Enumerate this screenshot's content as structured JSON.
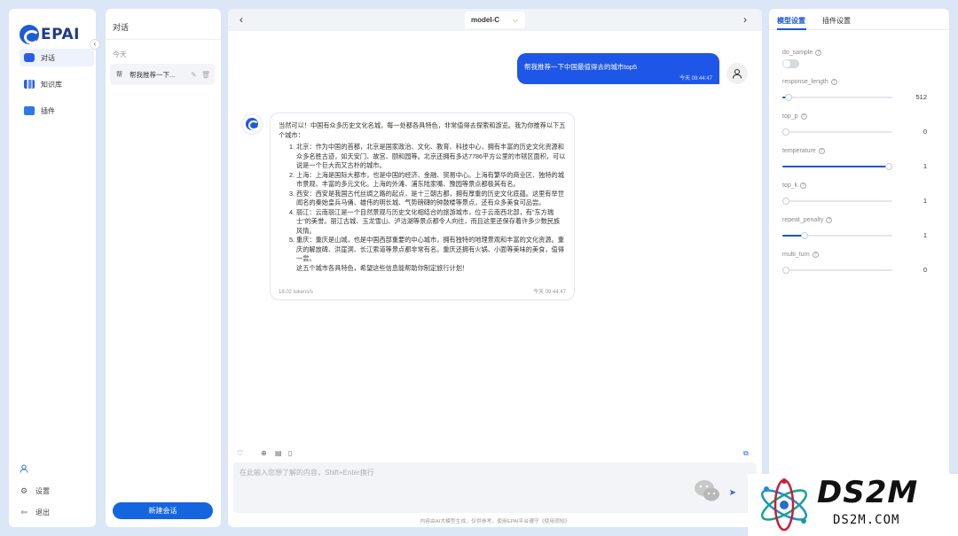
{
  "brand": {
    "name": "EPAI"
  },
  "nav": {
    "items": [
      {
        "label": "对话",
        "icon": "chat-icon",
        "active": true
      },
      {
        "label": "知识库",
        "icon": "books-icon",
        "active": false
      },
      {
        "label": "插件",
        "icon": "plugin-icon",
        "active": false
      }
    ],
    "footer": {
      "settings": "设置",
      "logout": "退出"
    }
  },
  "conversations": {
    "title": "对话",
    "group": "今天",
    "items": [
      {
        "title": "帮我推荐一下..."
      }
    ],
    "new_chat": "新建会话"
  },
  "chat": {
    "model": "model-C",
    "user_message": {
      "text": "帮我推荐一下中国最值得去的城市top5",
      "time": "今天 09:44:47"
    },
    "bot_message": {
      "intro": "当然可以！中国有众多历史文化名城，每一处都各具特色，非常值得去探索和游览。我为你推荐以下五个城市：",
      "items": [
        "北京：作为中国的首都，北京是国家政治、文化、教育、科技中心，拥有丰富的历史文化资源和众多名胜古迹，如天安门、故宫、颐和园等。北京还拥有多达7786平方公里的市辖区面积，可以说是一个巨大而又古朴的城市。",
        "上海：上海是国际大都市，也是中国的经济、金融、贸易中心。上海有繁华的商业区、独特的城市景观、丰富的多元文化。上海的外滩、浦东陆家嘴、豫园等景点都极其有名。",
        "西安：西安是我国古代丝绸之路的起点，是十三朝古都，拥有厚重的历史文化底蕴。这里有举世闻名的秦始皇兵马俑、雄伟的明长城、气势磅礴的钟鼓楼等景点，还有众多美食可品尝。",
        "丽江：云南丽江是一个自然景观与历史文化相结合的旅游城市，位于云南西北部，有\"东方瑞士\"的美誉。丽江古城、玉龙雪山、泸沽湖等景点都令人向往，而且这里还保存着许多少数民族风情。",
        "重庆：重庆是山城，也是中国西部重要的中心城市，拥有独特的地理景观和丰富的文化资源。重庆的解放碑、洪崖洞、长江索道等景点都非常有名。重庆还拥有火锅、小面等美味的美食，值得一尝。"
      ],
      "outro": "这五个城市各具特色，希望这些信息能帮助你制定旅行计划！",
      "speed": "18.02 tokens/s",
      "time": "今天 09:44:47"
    },
    "input_placeholder": "在此输入您想了解的内容，Shift+Enter换行",
    "disclaimer": "内容由AI大模型生成，仅供参考。使用EPAI平台遵守《使用须知》"
  },
  "settings": {
    "tabs": [
      "模型设置",
      "插件设置"
    ],
    "params": [
      {
        "name": "do_sample",
        "kind": "toggle",
        "on": false
      },
      {
        "name": "response_length",
        "kind": "slider",
        "value": "512",
        "level": 0.06
      },
      {
        "name": "top_p",
        "kind": "slider",
        "value": "0",
        "level": 0
      },
      {
        "name": "temperature",
        "kind": "slider",
        "value": "1",
        "level": 1
      },
      {
        "name": "top_k",
        "kind": "slider",
        "value": "1",
        "level": 0
      },
      {
        "name": "repeat_penalty",
        "kind": "slider",
        "value": "1",
        "level": 0.2
      },
      {
        "name": "multi_turn",
        "kind": "slider",
        "value": "0",
        "level": 0
      }
    ]
  },
  "watermark": {
    "title": "DS2M",
    "subtitle": "DS2M.COM"
  },
  "colors": {
    "accent": "#1a56d6",
    "user_bubble": "#1e56e8",
    "background": "#dbe6f7"
  }
}
